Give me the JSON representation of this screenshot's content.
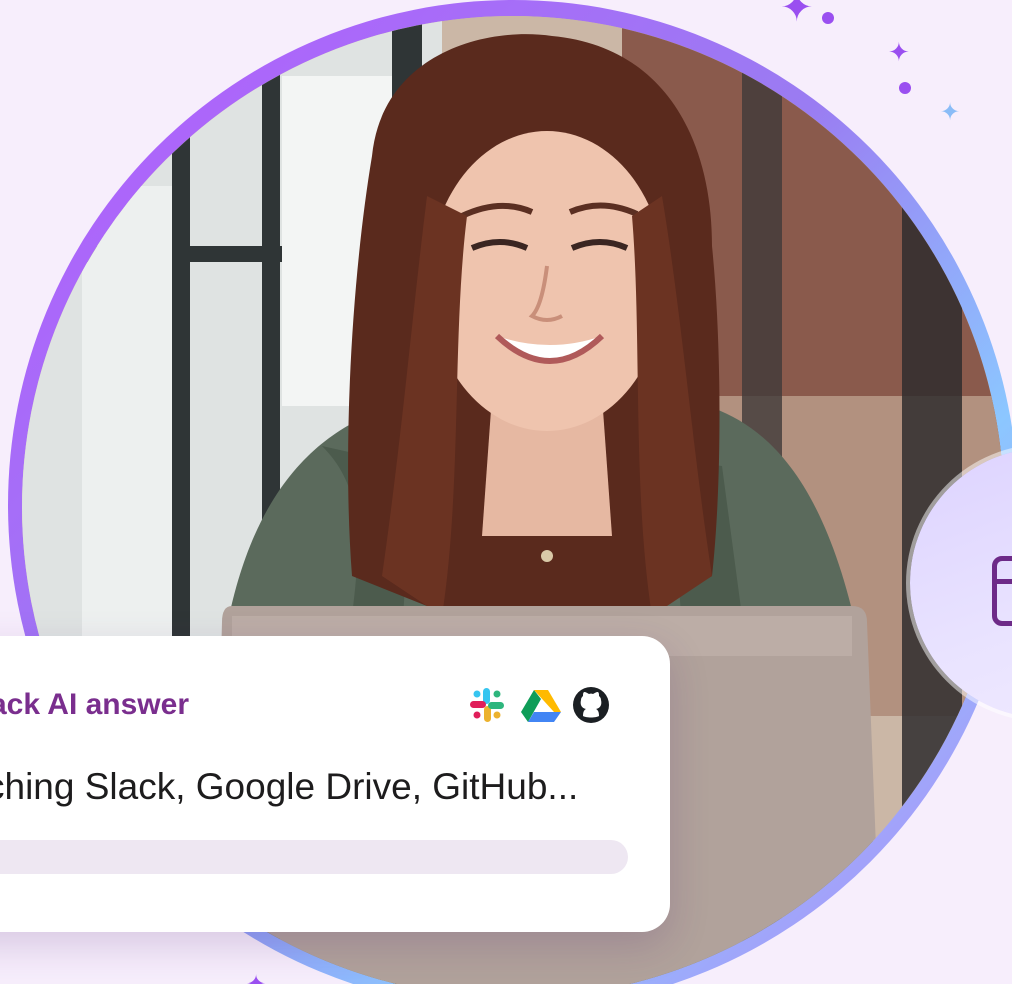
{
  "card": {
    "title": "ack AI answer",
    "status": "ching Slack, Google Drive, GitHub...",
    "sources": [
      "slack-icon",
      "google-drive-icon",
      "github-icon"
    ],
    "progress": 0.0
  },
  "colors": {
    "title": "#7a2e8e",
    "ring": "#b55bff",
    "sparkle": "#9a4ff0",
    "sparkle_blue": "#8abcf7"
  }
}
